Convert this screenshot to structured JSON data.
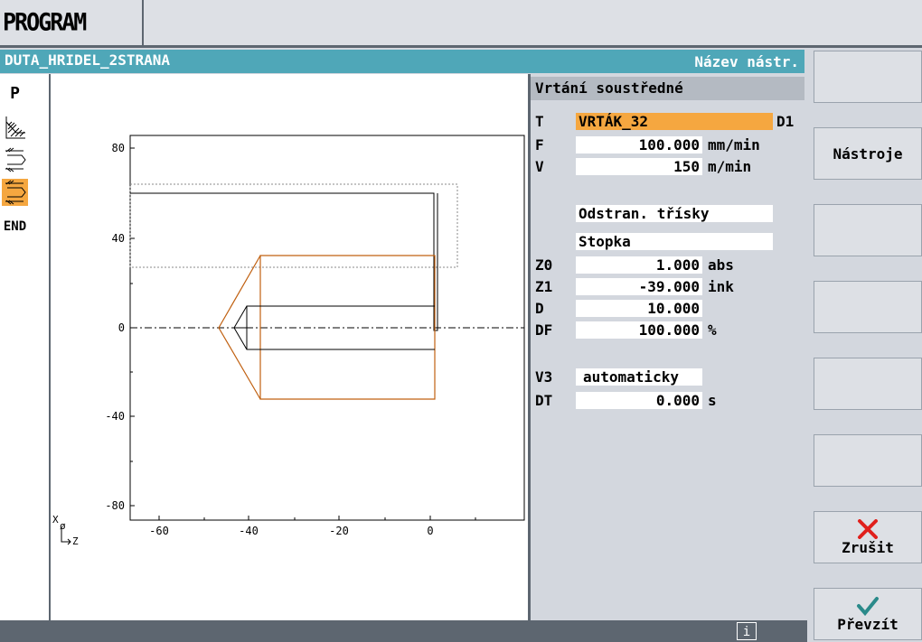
{
  "app": {
    "title": "PROGRAM"
  },
  "header": {
    "program_name": "DUTA_HRIDEL_2STRANA",
    "hint": "Název nástr."
  },
  "left_strip": [
    {
      "label": "P",
      "icon": "program-icon"
    },
    {
      "label": "",
      "icon": "turning-icon"
    },
    {
      "label": "",
      "icon": "drill-icon"
    },
    {
      "label": "",
      "icon": "drill-center-icon"
    },
    {
      "label": "END",
      "icon": "end-icon"
    }
  ],
  "graphics": {
    "y_ticks": [
      "80",
      "40",
      "0",
      "-40",
      "-80"
    ],
    "x_ticks": [
      "-60",
      "-40",
      "-20",
      "0"
    ],
    "axis_x": "X",
    "axis_z": "Z"
  },
  "form": {
    "title": "Vrtání soustředné",
    "t_label": "T",
    "t_value": "VRTÁK_32",
    "d_label": "D1",
    "f_label": "F",
    "f_value": "100.000",
    "f_unit": "mm/min",
    "v_label": "V",
    "v_value": "150",
    "v_unit": "m/min",
    "chip_mode": "Odstran. třísky",
    "shank": "Stopka",
    "z0_label": "Z0",
    "z0_value": "1.000",
    "z0_unit": "abs",
    "z1_label": "Z1",
    "z1_value": "-39.000",
    "z1_unit": "ink",
    "d_lbl": "D",
    "d_value": "10.000",
    "df_label": "DF",
    "df_value": "100.000",
    "df_unit": "%",
    "v3_label": "V3",
    "v3_value": "automaticky",
    "dt_label": "DT",
    "dt_value": "0.000",
    "dt_unit": "s"
  },
  "softkeys": {
    "sk1": "",
    "sk2": "Nástroje",
    "sk3": "",
    "sk4": "",
    "sk5": "",
    "sk6": "",
    "cancel": "Zrušit",
    "accept": "Převzít"
  },
  "status": {
    "info": "i"
  },
  "colors": {
    "header": "#4fa7b8",
    "active": "#f5a740",
    "tool": "#c06010"
  }
}
